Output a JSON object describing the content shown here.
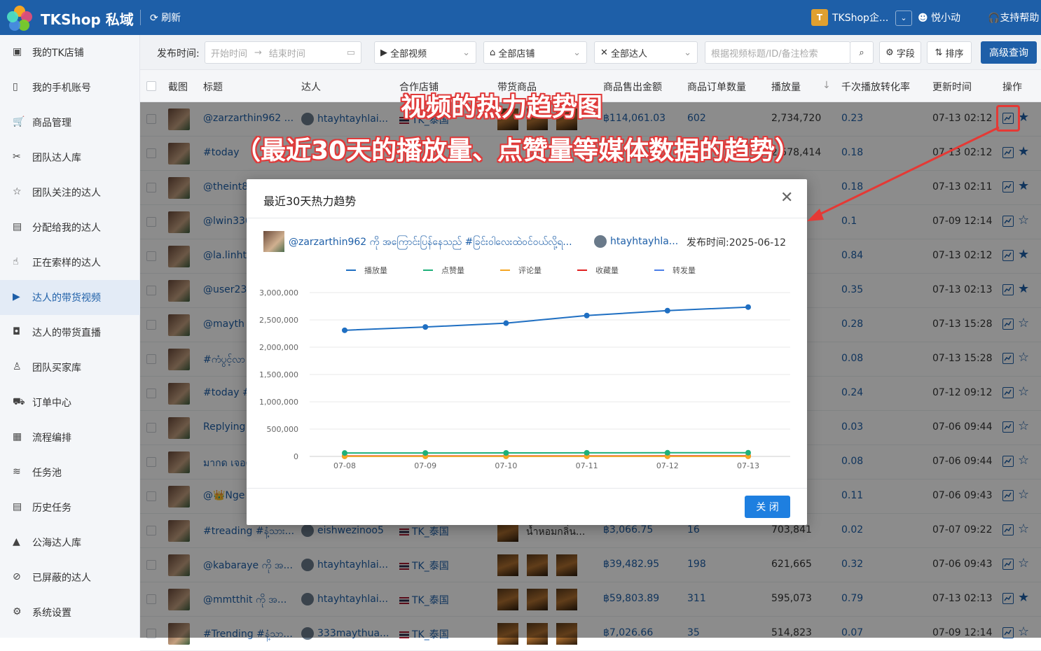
{
  "app": {
    "name": "TKShop 私域",
    "refresh": "刷新",
    "shop": "TKShop企...",
    "shop_initial": "T",
    "user": "悦小动",
    "help": "支持帮助"
  },
  "sidebar": {
    "items": [
      {
        "label": "我的TK店铺",
        "icon": "shop-icon"
      },
      {
        "label": "我的手机账号",
        "icon": "phone-icon"
      },
      {
        "label": "商品管理",
        "icon": "cart-icon"
      },
      {
        "label": "团队达人库",
        "icon": "users-icon"
      },
      {
        "label": "团队关注的达人",
        "icon": "star-icon"
      },
      {
        "label": "分配给我的达人",
        "icon": "assign-icon"
      },
      {
        "label": "正在索样的达人",
        "icon": "hand-icon"
      },
      {
        "label": "达人的带货视频",
        "icon": "video-icon"
      },
      {
        "label": "达人的带货直播",
        "icon": "live-icon"
      },
      {
        "label": "团队买家库",
        "icon": "buyer-icon"
      },
      {
        "label": "订单中心",
        "icon": "truck-icon"
      },
      {
        "label": "流程编排",
        "icon": "flow-icon"
      },
      {
        "label": "任务池",
        "icon": "layers-icon"
      },
      {
        "label": "历史任务",
        "icon": "clipboard-icon"
      },
      {
        "label": "公海达人库",
        "icon": "sea-icon"
      },
      {
        "label": "已屏蔽的达人",
        "icon": "ban-icon"
      },
      {
        "label": "系统设置",
        "icon": "gear-icon"
      }
    ],
    "active": 7
  },
  "filters": {
    "label": "发布时间:",
    "start_placeholder": "开始时间",
    "end_placeholder": "结束时间",
    "video": "全部视频",
    "store": "全部店铺",
    "creator": "全部达人",
    "search_placeholder": "根据视频标题/ID/备注检索",
    "fields": "字段",
    "sort": "排序",
    "advanced": "高级查询"
  },
  "table": {
    "headers": [
      "截图",
      "标题",
      "达人",
      "合作店铺",
      "带货商品",
      "商品售出金额",
      "商品订单数量",
      "播放量",
      "千次播放转化率",
      "更新时间",
      "操作"
    ],
    "rows": [
      {
        "title": "@zarzarthin962 ...",
        "creator": "htayhtayhlai...",
        "store": "TK_泰国",
        "amount": "฿114,061.03",
        "orders": "602",
        "plays": "2,734,720",
        "rate": "0.23",
        "time": "07-13 02:12",
        "fav": true
      },
      {
        "title": "#today",
        "creator": "",
        "store": "",
        "amount": "",
        "orders": "",
        "plays": "2,578,414",
        "rate": "0.18",
        "time": "07-13 02:12",
        "fav": true
      },
      {
        "title": "@theint8",
        "creator": "",
        "store": "",
        "amount": "",
        "orders": "",
        "plays": "53",
        "rate": "0.18",
        "time": "07-13 02:11",
        "fav": true
      },
      {
        "title": "@lwin336",
        "creator": "",
        "store": "",
        "amount": "",
        "orders": "",
        "plays": "51",
        "rate": "0.1",
        "time": "07-09 12:14",
        "fav": false
      },
      {
        "title": "@la.linhte",
        "creator": "",
        "store": "",
        "amount": "",
        "orders": "",
        "plays": "06",
        "rate": "0.84",
        "time": "07-13 02:12",
        "fav": true
      },
      {
        "title": "@user237",
        "creator": "",
        "store": "",
        "amount": "",
        "orders": "",
        "plays": "35",
        "rate": "0.35",
        "time": "07-13 02:13",
        "fav": true
      },
      {
        "title": "@mayth",
        "creator": "",
        "store": "",
        "amount": "",
        "orders": "",
        "plays": "",
        "rate": "0.28",
        "time": "07-13 15:28",
        "fav": false
      },
      {
        "title": "#ကံပွင့်လာ",
        "creator": "",
        "store": "",
        "amount": "",
        "orders": "",
        "plays": "20",
        "rate": "0.08",
        "time": "07-13 15:28",
        "fav": false
      },
      {
        "title": "#today #",
        "creator": "",
        "store": "",
        "amount": "",
        "orders": "",
        "plays": "",
        "rate": "0.24",
        "time": "07-12 09:12",
        "fav": false
      },
      {
        "title": "Replying",
        "creator": "",
        "store": "",
        "amount": "",
        "orders": "",
        "plays": "",
        "rate": "0.03",
        "time": "07-06 09:44",
        "fav": false
      },
      {
        "title": "มากด เจอด",
        "creator": "",
        "store": "",
        "amount": "",
        "orders": "",
        "plays": "",
        "rate": "0.08",
        "time": "07-06 09:44",
        "fav": false
      },
      {
        "title": "@👑Nge",
        "creator": "",
        "store": "",
        "amount": "",
        "orders": "",
        "plays": "",
        "rate": "0.11",
        "time": "07-06 09:43",
        "fav": false
      },
      {
        "title": "#treading #နံ့သား...",
        "creator": "eishwezinoo5",
        "store": "TK_泰国",
        "amount": "฿3,066.75",
        "orders": "16",
        "plays": "703,841",
        "rate": "0.02",
        "time": "07-07 09:22",
        "fav": false,
        "product": "น้ำหอมกลิ่น..."
      },
      {
        "title": "@kabaraye ကို အ...",
        "creator": "htayhtayhlai...",
        "store": "TK_泰国",
        "amount": "฿39,482.95",
        "orders": "198",
        "plays": "621,665",
        "rate": "0.32",
        "time": "07-06 09:43",
        "fav": false
      },
      {
        "title": "@mmtthit ကို အ...",
        "creator": "htayhtayhlai...",
        "store": "TK_泰国",
        "amount": "฿59,803.89",
        "orders": "311",
        "plays": "595,073",
        "rate": "0.79",
        "time": "07-13 02:13",
        "fav": true
      },
      {
        "title": "#Trending #နံ့သာ...",
        "creator": "333maythua...",
        "store": "TK_泰国",
        "amount": "฿7,026.66",
        "orders": "35",
        "plays": "514,823",
        "rate": "0.07",
        "time": "07-09 12:14",
        "fav": false
      }
    ]
  },
  "annotation": {
    "line1": "视频的热力趋势图",
    "line2": "（最近30天的播放量、点赞量等媒体数据的趋势）"
  },
  "modal": {
    "title": "最近30天热力趋势",
    "video_title": "@zarzarthin962 ကို အကြောင်းပြန်နေသည် #ခြင်းဝါလေးထဲဝင်ဝယ်လို့ရ...",
    "author": "htayhtayhla...",
    "publish_label": "发布时间:",
    "publish_date": "2025-06-12",
    "ok": "关 闭"
  },
  "chart_data": {
    "type": "line",
    "x": [
      "07-08",
      "07-09",
      "07-10",
      "07-11",
      "07-12",
      "07-13"
    ],
    "series": [
      {
        "name": "播放量",
        "color": "#1f6fc2",
        "values": [
          2310000,
          2370000,
          2440000,
          2580000,
          2670000,
          2734720
        ]
      },
      {
        "name": "点赞量",
        "color": "#1fb07a",
        "values": [
          62000,
          63000,
          64000,
          66000,
          67000,
          68000
        ]
      },
      {
        "name": "评论量",
        "color": "#f5a623",
        "values": [
          1200,
          1250,
          1300,
          1350,
          1380,
          1400
        ]
      },
      {
        "name": "收藏量",
        "color": "#e02020",
        "values": [
          8000,
          8200,
          8400,
          8700,
          8900,
          9000
        ]
      },
      {
        "name": "转发量",
        "color": "#4a7ee8",
        "values": [
          3000,
          3100,
          3200,
          3300,
          3350,
          3400
        ]
      }
    ],
    "yticks": [
      "0",
      "500,000",
      "1,000,000",
      "1,500,000",
      "2,000,000",
      "2,500,000",
      "3,000,000"
    ],
    "ylim": [
      0,
      3000000
    ],
    "legend": "top-center",
    "grid": true
  }
}
